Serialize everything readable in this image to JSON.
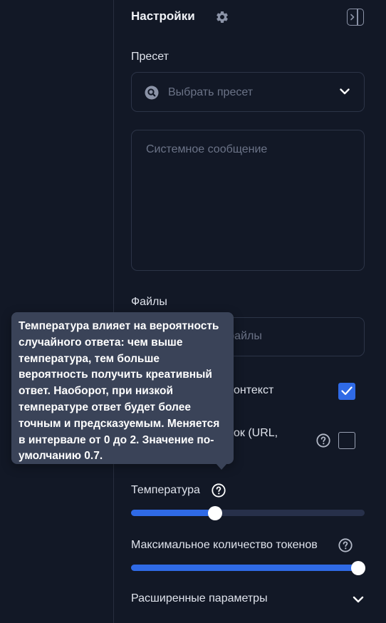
{
  "header": {
    "title": "Настройки"
  },
  "preset": {
    "label": "Пресет",
    "placeholder": "Выбрать пресет"
  },
  "system_message": {
    "placeholder": "Системное сообщение"
  },
  "files": {
    "label": "Файлы",
    "placeholder_visible": "файлы"
  },
  "options": {
    "context_label_visible": "онтекст",
    "context_checked": true,
    "links_label_visible": "ок (URL,",
    "links_checked": false
  },
  "temperature": {
    "label": "Температура",
    "value_fraction": 0.36
  },
  "max_tokens": {
    "label": "Максимальное количество токенов",
    "value_fraction": 1.0
  },
  "advanced": {
    "label": "Расширенные параметры"
  },
  "tooltip": {
    "text": "Температура влияет на вероятность случайного ответа: чем выше температура, тем больше вероятность получить креативный ответ. Наоборот, при низкой температуре ответ будет более точным и предсказуемым. Меняется в интервале от 0 до 2. Значение по-умолчанию 0.7."
  },
  "colors": {
    "accent": "#2f6ae6",
    "background": "#121826",
    "tooltip_bg": "#3a4358"
  },
  "icons": [
    "gear-icon",
    "sidebar-collapse-icon",
    "search-icon",
    "chevron-down-icon",
    "checkmark-icon",
    "help-icon"
  ]
}
